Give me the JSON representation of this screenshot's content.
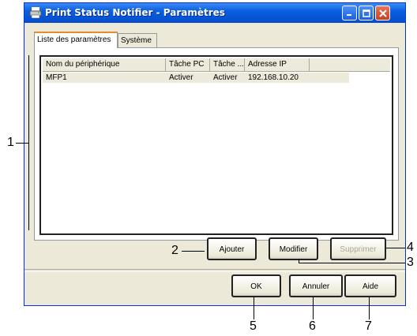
{
  "window": {
    "title": "Print Status Notifier - Paramètres",
    "icon": "printer-icon"
  },
  "tabs": [
    {
      "label": "Liste des paramètres",
      "active": true
    },
    {
      "label": "Système",
      "active": false
    }
  ],
  "list": {
    "columns": [
      "Nom du périphérique",
      "Tâche PC",
      "Tâche ...",
      "Adresse IP"
    ],
    "rows": [
      {
        "name": "MFP1",
        "pc_task": "Activer",
        "task": "Activer",
        "ip": "192.168.10.20"
      }
    ]
  },
  "actions": {
    "add": "Ajouter",
    "modify": "Modifier",
    "delete": "Supprimer"
  },
  "dialog_buttons": {
    "ok": "OK",
    "cancel": "Annuler",
    "help": "Aide"
  },
  "callouts": {
    "c1": "1",
    "c2": "2",
    "c3": "3",
    "c4": "4",
    "c5": "5",
    "c6": "6",
    "c7": "7"
  }
}
